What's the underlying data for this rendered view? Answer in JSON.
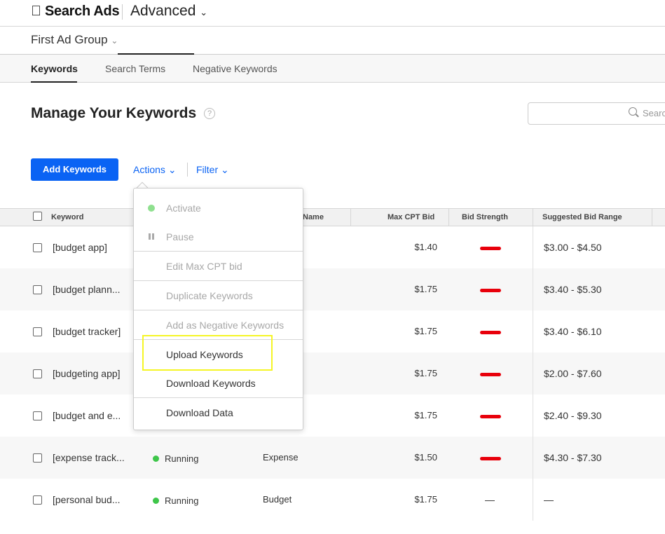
{
  "header": {
    "brand": "Search Ads",
    "mode": "Advanced"
  },
  "adgroup": {
    "name": "First Ad Group"
  },
  "tabs": [
    {
      "label": "Keywords",
      "active": true
    },
    {
      "label": "Search Terms"
    },
    {
      "label": "Negative Keywords"
    }
  ],
  "page": {
    "title": "Manage Your Keywords",
    "help": "?"
  },
  "search": {
    "placeholder": "Search"
  },
  "toolbar": {
    "add": "Add Keywords",
    "actions": "Actions",
    "filter": "Filter"
  },
  "table": {
    "headers": [
      "Keyword",
      "Name",
      "Max CPT Bid",
      "Bid Strength",
      "Suggested Bid Range"
    ],
    "rows": [
      {
        "keyword": "[budget app]",
        "status": "",
        "adgroup": "",
        "bid": "$1.40",
        "strength": "weak",
        "range": "$3.00 - $4.50"
      },
      {
        "keyword": "[budget plann...",
        "status": "",
        "adgroup": "",
        "bid": "$1.75",
        "strength": "weak",
        "range": "$3.40 - $5.30"
      },
      {
        "keyword": "[budget tracker]",
        "status": "",
        "adgroup": "",
        "bid": "$1.75",
        "strength": "weak",
        "range": "$3.40 - $6.10"
      },
      {
        "keyword": "[budgeting app]",
        "status": "",
        "adgroup": "",
        "bid": "$1.75",
        "strength": "weak",
        "range": "$2.00 - $7.60"
      },
      {
        "keyword": "[budget and e...",
        "status": "",
        "adgroup": "",
        "bid": "$1.75",
        "strength": "weak",
        "range": "$2.40 - $9.30"
      },
      {
        "keyword": "[expense track...",
        "status": "Running",
        "adgroup": "Expense",
        "bid": "$1.50",
        "strength": "weak",
        "range": "$4.30 - $7.30"
      },
      {
        "keyword": "[personal bud...",
        "status": "Running",
        "adgroup": "Budget",
        "bid": "$1.75",
        "strength": "—",
        "range": "—"
      }
    ]
  },
  "menu": {
    "items": [
      {
        "label": "Activate",
        "enabled": false
      },
      {
        "label": "Pause",
        "enabled": false
      },
      {
        "label": "Edit Max CPT bid",
        "enabled": false
      },
      {
        "label": "Duplicate Keywords",
        "enabled": false
      },
      {
        "label": "Add as Negative Keywords",
        "enabled": false
      },
      {
        "label": "Upload Keywords",
        "enabled": true,
        "highlighted": true
      },
      {
        "label": "Download Keywords",
        "enabled": true
      },
      {
        "label": "Download Data",
        "enabled": true
      }
    ]
  },
  "colors": {
    "accent": "#0a63f4",
    "running": "#3ec64a",
    "weak": "#e8000b",
    "highlight": "#f5f526"
  }
}
